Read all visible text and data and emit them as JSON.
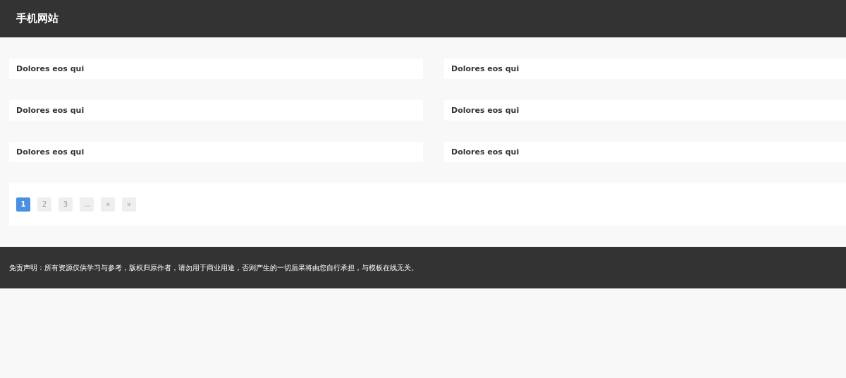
{
  "header": {
    "title": "手机网站"
  },
  "items": [
    {
      "title": "Dolores eos qui"
    },
    {
      "title": "Dolores eos qui"
    },
    {
      "title": "Dolores eos qui"
    },
    {
      "title": "Dolores eos qui"
    },
    {
      "title": "Dolores eos qui"
    },
    {
      "title": "Dolores eos qui"
    }
  ],
  "pagination": [
    {
      "label": "1",
      "selected": true
    },
    {
      "label": "2",
      "selected": false
    },
    {
      "label": "3",
      "selected": false
    },
    {
      "label": "...",
      "selected": false
    },
    {
      "label": "«",
      "selected": false
    },
    {
      "label": "»",
      "selected": false
    }
  ],
  "footer": {
    "text": "免责声明：所有资源仅供学习与参考，版权归原作者，请勿用于商业用途，否则产生的一切后果将由您自行承担，与模板在线无关。"
  }
}
